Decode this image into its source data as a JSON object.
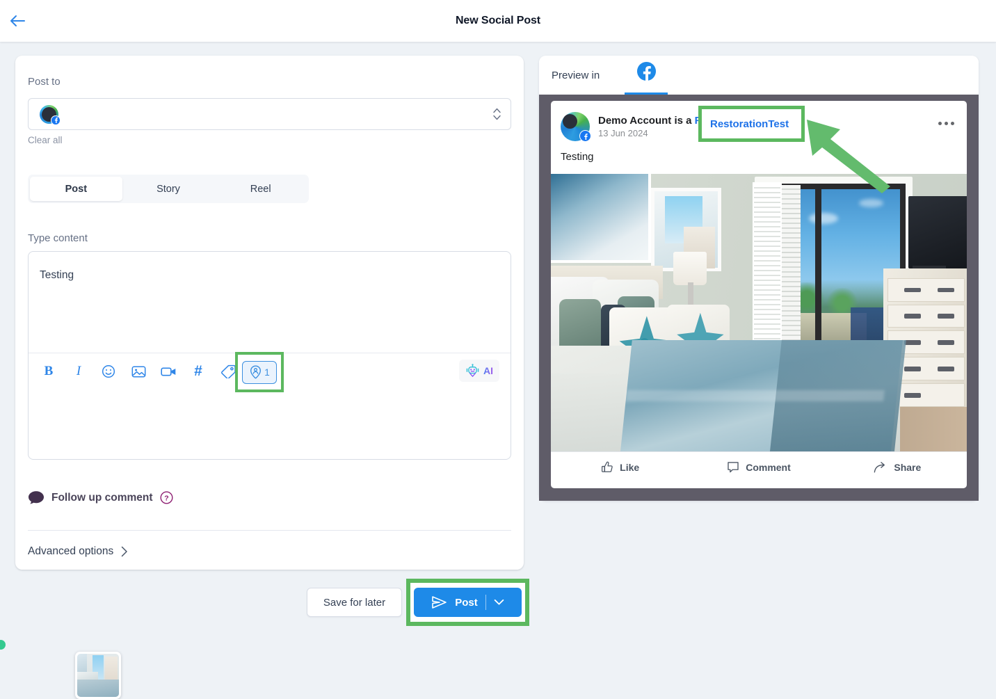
{
  "header": {
    "title": "New Social Post",
    "back_icon": "arrow-left-icon"
  },
  "editor": {
    "post_to_label": "Post to",
    "clear_all": "Clear all",
    "account_icon": "account-avatar",
    "platform_badge": "facebook-badge-icon",
    "stepper_icon": "chevron-up-down-icon",
    "tabs": [
      {
        "label": "Post",
        "active": true
      },
      {
        "label": "Story",
        "active": false
      },
      {
        "label": "Reel",
        "active": false
      }
    ],
    "type_content_label": "Type content",
    "content_value": "Testing",
    "content_placeholder": "Type content",
    "toolbar": [
      {
        "name": "bold-icon",
        "label": "B"
      },
      {
        "name": "italic-icon",
        "label": "I"
      },
      {
        "name": "emoji-icon",
        "label": ""
      },
      {
        "name": "image-icon",
        "label": ""
      },
      {
        "name": "video-icon",
        "label": ""
      },
      {
        "name": "hashtag-icon",
        "label": "#"
      },
      {
        "name": "tag-icon",
        "label": ""
      }
    ],
    "location_button": {
      "icon": "location-person-pin-icon",
      "count": "1"
    },
    "ai_button": {
      "icon": "robot-icon",
      "label": "AI"
    },
    "attachment_alt": "bedroom-photo-thumbnail",
    "follow_up_comment": "Follow up comment",
    "follow_up_icon": "speech-bubble-icon",
    "help_icon": "question-mark-icon",
    "advanced_options": "Advanced options",
    "advanced_chevron": "chevron-right-icon"
  },
  "footer": {
    "save_label": "Save for later",
    "post_label": "Post",
    "post_icon": "send-icon",
    "post_dropdown_icon": "chevron-down-icon"
  },
  "preview": {
    "label": "Preview in",
    "tab_icon": "facebook-icon",
    "post": {
      "author_prefix": "Demo Account is a",
      "mention": "RestorationTest",
      "date": "13 Jun 2024",
      "body": "Testing",
      "menu_icon": "more-options-icon",
      "image_alt": "coastal-bedroom-interior",
      "actions": [
        {
          "label": "Like",
          "icon": "thumbs-up-icon"
        },
        {
          "label": "Comment",
          "icon": "comment-bubble-icon"
        },
        {
          "label": "Share",
          "icon": "share-arrow-icon"
        }
      ]
    }
  },
  "annotations": {
    "highlight_color": "#5cb85f",
    "arrow_icon": "pointer-arrow-icon",
    "status_dot_color": "#33c98f"
  },
  "colors": {
    "accent": "#1e8ae8",
    "page_bg": "#eef2f6",
    "frame": "#5f5c68"
  }
}
